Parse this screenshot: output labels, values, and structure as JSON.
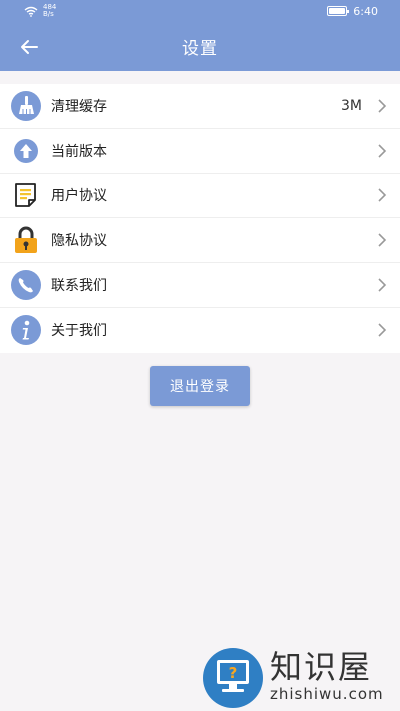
{
  "status_bar": {
    "net_speed_value": "484",
    "net_speed_unit": "B/s",
    "time": "6:40"
  },
  "navbar": {
    "title": "设置"
  },
  "settings": {
    "items": [
      {
        "label": "清理缓存",
        "value": "3M",
        "icon": "broom-icon"
      },
      {
        "label": "当前版本",
        "value": "",
        "icon": "upload-arrow-icon"
      },
      {
        "label": "用户协议",
        "value": "",
        "icon": "document-icon"
      },
      {
        "label": "隐私协议",
        "value": "",
        "icon": "lock-icon"
      },
      {
        "label": "联系我们",
        "value": "",
        "icon": "phone-icon"
      },
      {
        "label": "关于我们",
        "value": "",
        "icon": "info-icon"
      }
    ]
  },
  "logout": {
    "label": "退出登录"
  },
  "watermark": {
    "cn": "知识屋",
    "en": "zhishiwu.com"
  },
  "colors": {
    "primary": "#7b9ad6",
    "background": "#f6f4f6",
    "lock_orange": "#f2a31b",
    "doc_yellow": "#f4c430"
  }
}
